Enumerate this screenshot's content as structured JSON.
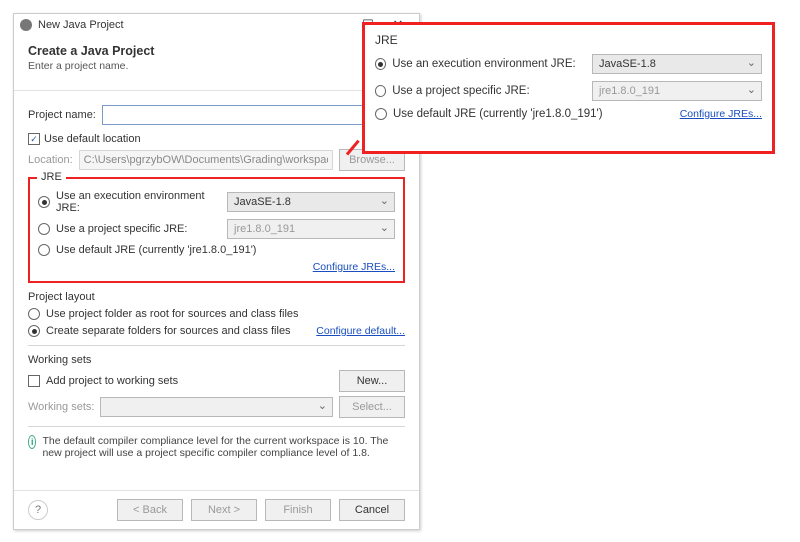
{
  "titlebar": {
    "title": "New Java Project",
    "maximize": "☐",
    "close": "✕"
  },
  "header": {
    "title": "Create a Java Project",
    "subtitle": "Enter a project name."
  },
  "projectName": {
    "label": "Project name:",
    "value": ""
  },
  "defaultLocation": {
    "label": "Use default location",
    "checked": true
  },
  "location": {
    "label": "Location:",
    "value": "C:\\Users\\pgrzybOW\\Documents\\Grading\\workspace",
    "browse": "Browse..."
  },
  "jre": {
    "groupTitle": "JRE",
    "opt1": {
      "label": "Use an execution environment JRE:",
      "value": "JavaSE-1.8",
      "selected": true
    },
    "opt2": {
      "label": "Use a project specific JRE:",
      "value": "jre1.8.0_191",
      "selected": false
    },
    "opt3": {
      "label": "Use default JRE (currently 'jre1.8.0_191')",
      "selected": false
    },
    "configure": "Configure JREs..."
  },
  "layout": {
    "groupTitle": "Project layout",
    "opt1": {
      "label": "Use project folder as root for sources and class files",
      "selected": false
    },
    "opt2": {
      "label": "Create separate folders for sources and class files",
      "selected": true
    },
    "configure": "Configure default..."
  },
  "workingSets": {
    "groupTitle": "Working sets",
    "add": {
      "label": "Add project to working sets",
      "checked": false
    },
    "newBtn": "New...",
    "label": "Working sets:",
    "value": "",
    "selectBtn": "Select..."
  },
  "info": "The default compiler compliance level for the current workspace is 10. The new project will use a project specific compiler compliance level of 1.8.",
  "footer": {
    "back": "< Back",
    "next": "Next >",
    "finish": "Finish",
    "cancel": "Cancel",
    "help": "?"
  }
}
